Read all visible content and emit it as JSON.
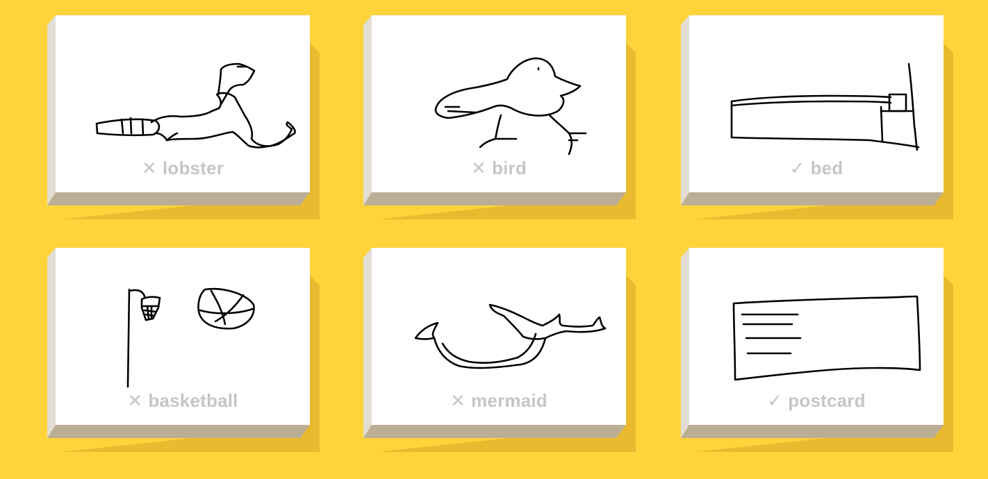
{
  "results": [
    {
      "mark": "✕",
      "word": "lobster"
    },
    {
      "mark": "✕",
      "word": "bird"
    },
    {
      "mark": "✓",
      "word": "bed"
    },
    {
      "mark": "✕",
      "word": "basketball"
    },
    {
      "mark": "✕",
      "word": "mermaid"
    },
    {
      "mark": "✓",
      "word": "postcard"
    }
  ],
  "colors": {
    "background": "#FFD43B",
    "card_face": "#FFFFFF",
    "card_left_edge": "#E2DED4",
    "card_bottom_edge": "#BCAE95",
    "card_shadow": "#E9BA2F",
    "label": "#C6C6C6",
    "ink": "#000000"
  }
}
